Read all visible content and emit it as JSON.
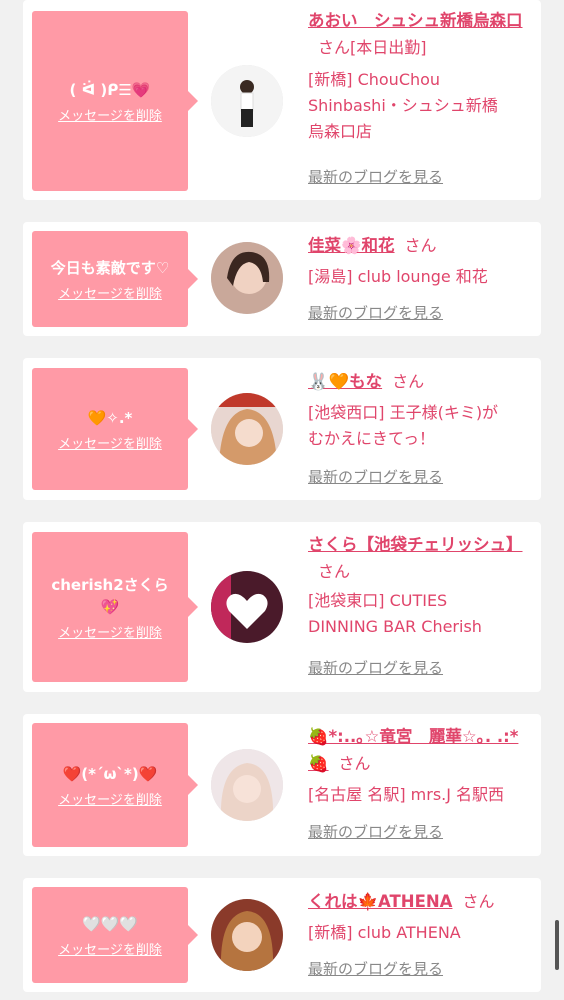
{
  "colors": {
    "accent": "#e0456b",
    "bubble": "#ff9aa6",
    "muted": "#888888"
  },
  "delete_label": "メッセージを削除",
  "blog_label": "最新のブログを見る",
  "san_label": "さん",
  "cards": [
    {
      "message": "( ᐛ )ᑭ☰💗",
      "name": "あおい　シュシュ新橋烏森口",
      "status": "[本日出勤]",
      "shop_lines": [
        "[新橋] ChouChou",
        "Shinbashi・シュシュ新橋",
        "烏森口店"
      ]
    },
    {
      "message": "今日も素敵です♡",
      "name": "佳菜🌸和花",
      "status": "",
      "shop_lines": [
        "[湯島] club lounge 和花"
      ]
    },
    {
      "message": "🧡✧.*",
      "name": "🐰🧡もな",
      "status": "",
      "shop_lines": [
        "[池袋西口] 王子様(キミ)が",
        "むかえにきてっ！"
      ]
    },
    {
      "message": "cherish2さくら💖",
      "name": "さくら【池袋チェリッシュ】",
      "status": "",
      "shop_lines": [
        "[池袋東口] CUTIES",
        "DINNING BAR Cherish"
      ]
    },
    {
      "message": "❤️(*´ω`*)❤️",
      "name": "🍓*:..｡☆竜宮　麗華☆｡. .:*🍓",
      "status": "",
      "shop_lines": [
        "[名古屋 名駅] mrs.J 名駅西"
      ]
    },
    {
      "message": "🤍🤍🤍",
      "name": "くれは🍁ATHENA",
      "status": "",
      "shop_lines": [
        "[新橋] club ATHENA"
      ]
    }
  ]
}
